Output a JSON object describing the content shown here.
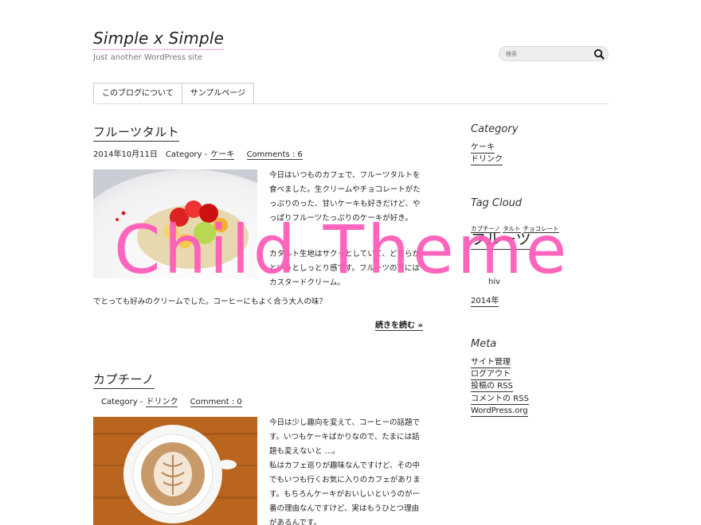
{
  "site": {
    "title": "Simple x Simple",
    "description": "Just another WordPress site"
  },
  "search": {
    "placeholder": "検索"
  },
  "nav": {
    "items": [
      "このブログについて",
      "サンプルページ"
    ]
  },
  "posts": [
    {
      "title": "フルーツタルト",
      "date": "2014年10月11日",
      "category_label": "Category -",
      "category": "ケーキ",
      "comments": "Comments : 6",
      "paragraphs": [
        "今日はいつものカフェで、フルーツタルトを食べました。生クリームやチョコレートがたっぷりのった、甘いケーキも好きだけど、やっぱりフルーツたっぷりのケーキが好き。",
        "カタルト生地はサクッとしていて、どちらかというとしっとり感です。フルーツの下にはカスタードクリーム。",
        "でとっても好みのクリームでした。コーヒーにもよく合う大人の味？"
      ],
      "read_more": "続きを読む »"
    },
    {
      "title": "カプチーノ",
      "category_label": "Category -",
      "category": "ドリンク",
      "comments": "Comment : 0",
      "paragraphs": [
        "今日は少し趣向を変えて、コーヒーの話題です。いつもケーキばかりなので、たまには話題も変えないと …。",
        "私はカフェ巡りが趣味なんですけど、その中でもいつも行くお気に入りのカフェがあります。もちろんケーキがおいしいというのが一番の理由なんですけど、実はもうひとつ理由があるんです。"
      ]
    }
  ],
  "sidebar": {
    "category": {
      "title": "Category",
      "items": [
        "ケーキ",
        "ドリンク"
      ]
    },
    "tag_cloud": {
      "title": "Tag Cloud",
      "small_tags": [
        "カプチーノ",
        "タルト",
        "チョコレート"
      ],
      "big_tag": "フルーツ"
    },
    "archives": {
      "partial_title": "hiv",
      "partial_item": "2014年"
    },
    "meta": {
      "title": "Meta",
      "items": [
        "サイト管理",
        "ログアウト",
        "投稿の RSS",
        "コメントの RSS",
        "WordPress.org"
      ]
    }
  },
  "watermark": "Child Theme",
  "colors": {
    "accent": "#ff59b8",
    "text": "#222222",
    "border": "#cccccc"
  }
}
